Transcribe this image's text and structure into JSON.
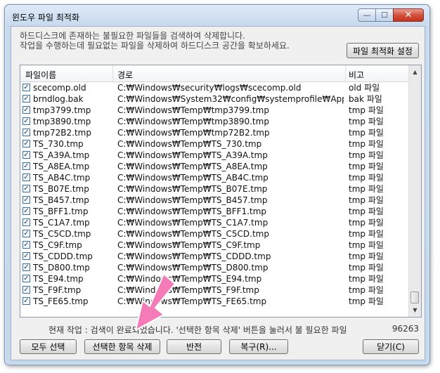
{
  "window": {
    "title": "윈도우 파일 최적화",
    "minimize_glyph": "—",
    "maximize_glyph": "☐",
    "close_glyph": "✕"
  },
  "description": {
    "line1": "하드디스크에 존재하는 불필요한 파일들을 검색하여 삭제합니다.",
    "line2": "작업을 수행하는데 필요없는 파일을 삭제하여 하드디스크 공간을 확보하세요."
  },
  "settings_button": "파일 최적화 설정",
  "list": {
    "columns": [
      "파일이름",
      "경로",
      "비고"
    ],
    "check_glyph": "✓",
    "rows": [
      {
        "name": "scecomp.old",
        "path": "C:₩Windows₩security₩logs₩scecomp.old",
        "note": "old 파일"
      },
      {
        "name": "brndlog.bak",
        "path": "C:₩Windows₩System32₩config₩systemprofile₩App...",
        "note": "bak 파일"
      },
      {
        "name": "tmp3799.tmp",
        "path": "C:₩Windows₩Temp₩tmp3799.tmp",
        "note": "tmp 파일"
      },
      {
        "name": "tmp3890.tmp",
        "path": "C:₩Windows₩Temp₩tmp3890.tmp",
        "note": "tmp 파일"
      },
      {
        "name": "tmp72B2.tmp",
        "path": "C:₩Windows₩Temp₩tmp72B2.tmp",
        "note": "tmp 파일"
      },
      {
        "name": "TS_730.tmp",
        "path": "C:₩Windows₩Temp₩TS_730.tmp",
        "note": "tmp 파일"
      },
      {
        "name": "TS_A39A.tmp",
        "path": "C:₩Windows₩Temp₩TS_A39A.tmp",
        "note": "tmp 파일"
      },
      {
        "name": "TS_A8EA.tmp",
        "path": "C:₩Windows₩Temp₩TS_A8EA.tmp",
        "note": "tmp 파일"
      },
      {
        "name": "TS_AB4C.tmp",
        "path": "C:₩Windows₩Temp₩TS_AB4C.tmp",
        "note": "tmp 파일"
      },
      {
        "name": "TS_B07E.tmp",
        "path": "C:₩Windows₩Temp₩TS_B07E.tmp",
        "note": "tmp 파일"
      },
      {
        "name": "TS_B457.tmp",
        "path": "C:₩Windows₩Temp₩TS_B457.tmp",
        "note": "tmp 파일"
      },
      {
        "name": "TS_BFF1.tmp",
        "path": "C:₩Windows₩Temp₩TS_BFF1.tmp",
        "note": "tmp 파일"
      },
      {
        "name": "TS_C1A7.tmp",
        "path": "C:₩Windows₩Temp₩TS_C1A7.tmp",
        "note": "tmp 파일"
      },
      {
        "name": "TS_C5CD.tmp",
        "path": "C:₩Windows₩Temp₩TS_C5CD.tmp",
        "note": "tmp 파일"
      },
      {
        "name": "TS_C9F.tmp",
        "path": "C:₩Windows₩Temp₩TS_C9F.tmp",
        "note": "tmp 파일"
      },
      {
        "name": "TS_CDDD.tmp",
        "path": "C:₩Windows₩Temp₩TS_CDDD.tmp",
        "note": "tmp 파일"
      },
      {
        "name": "TS_D800.tmp",
        "path": "C:₩Windows₩Temp₩TS_D800.tmp",
        "note": "tmp 파일"
      },
      {
        "name": "TS_E94.tmp",
        "path": "C:₩Windows₩Temp₩TS_E94.tmp",
        "note": "tmp 파일"
      },
      {
        "name": "TS_F9F.tmp",
        "path": "C:₩Windows₩Temp₩TS_F9F.tmp",
        "note": "tmp 파일"
      },
      {
        "name": "TS_FE65.tmp",
        "path": "C:₩Windows₩Temp₩TS_FE65.tmp",
        "note": "tmp 파일"
      }
    ],
    "scroll_up_glyph": "▲",
    "scroll_down_glyph": "▼"
  },
  "status": {
    "text": "현재 작업 : 검색이 완료되었습니다. '선택한 항목 삭제' 버튼을 눌러서 불 필요한 파일",
    "count": "96263"
  },
  "buttons": {
    "select_all": "모두 선택",
    "delete_selected": "선택한 항목 삭제",
    "invert": "반전",
    "restore": "복구(R)...",
    "close": "닫기(C)"
  },
  "colors": {
    "arrow": "#f47bb8"
  }
}
